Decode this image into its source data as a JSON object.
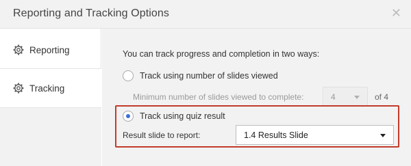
{
  "dialog": {
    "title": "Reporting and Tracking Options",
    "close_icon": "close-icon"
  },
  "sidebar": {
    "items": [
      {
        "label": "Reporting",
        "icon": "gear-icon",
        "selected": false
      },
      {
        "label": "Tracking",
        "icon": "gear-icon",
        "selected": true
      }
    ]
  },
  "tracking": {
    "intro": "You can track progress and completion in two ways:",
    "option_slides": {
      "label": "Track using number of slides viewed",
      "checked": false
    },
    "min_slides": {
      "label": "Minimum number of slides viewed to complete:",
      "value": "4",
      "of_label": "of 4",
      "disabled": true
    },
    "option_quiz": {
      "label": "Track using quiz result",
      "checked": true
    },
    "result_slide": {
      "label": "Result slide to report:",
      "value": "1.4 Results Slide"
    }
  },
  "colors": {
    "highlight_border": "#c23a2a",
    "radio_dot": "#3b6fd8",
    "panel_bg": "#f2f2f2"
  }
}
